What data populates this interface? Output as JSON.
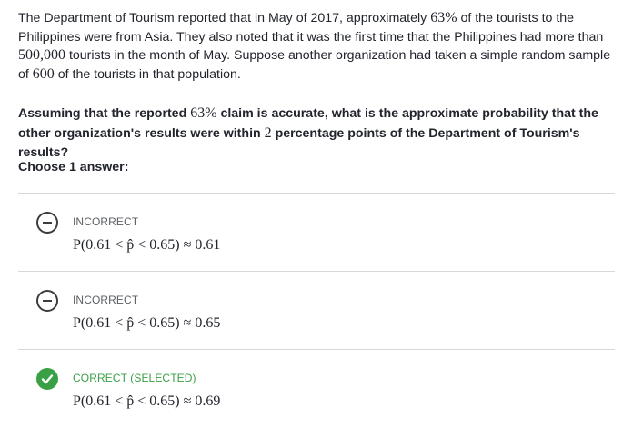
{
  "passage": {
    "t1": "The Department of Tourism reported that in May of 2017, approximately ",
    "m1": "63%",
    "t2": " of the tourists to the Philippines were from Asia. They also noted that it was the first time that the Philippines had more than ",
    "m2": "500,000",
    "t3": " tourists in the month of May. Suppose another organization had taken a simple random sample of ",
    "m3": "600",
    "t4": " of the tourists in that population."
  },
  "question": {
    "t1": "Assuming that the reported ",
    "m1": "63%",
    "t2": " claim is accurate, what is the approximate probability that the other organization's results were within ",
    "m2": "2",
    "t3": " percentage points of the Department of Tourism's results?"
  },
  "choose_label": "Choose 1 answer:",
  "choices": [
    {
      "status": "INCORRECT",
      "answer": "P(0.61 < p̂ < 0.65) ≈ 0.61",
      "state": "incorrect"
    },
    {
      "status": "INCORRECT",
      "answer": "P(0.61 < p̂ < 0.65) ≈ 0.65",
      "state": "incorrect"
    },
    {
      "status": "CORRECT (SELECTED)",
      "answer": "P(0.61 < p̂ < 0.65) ≈ 0.69",
      "state": "correct"
    }
  ],
  "colors": {
    "correct_green": "#3aa046",
    "text": "#21242c",
    "muted": "#5b5e62",
    "divider": "#d6d8da"
  },
  "icons": {
    "incorrect": "minus-circle-icon",
    "correct": "checkmark-circle-icon"
  }
}
